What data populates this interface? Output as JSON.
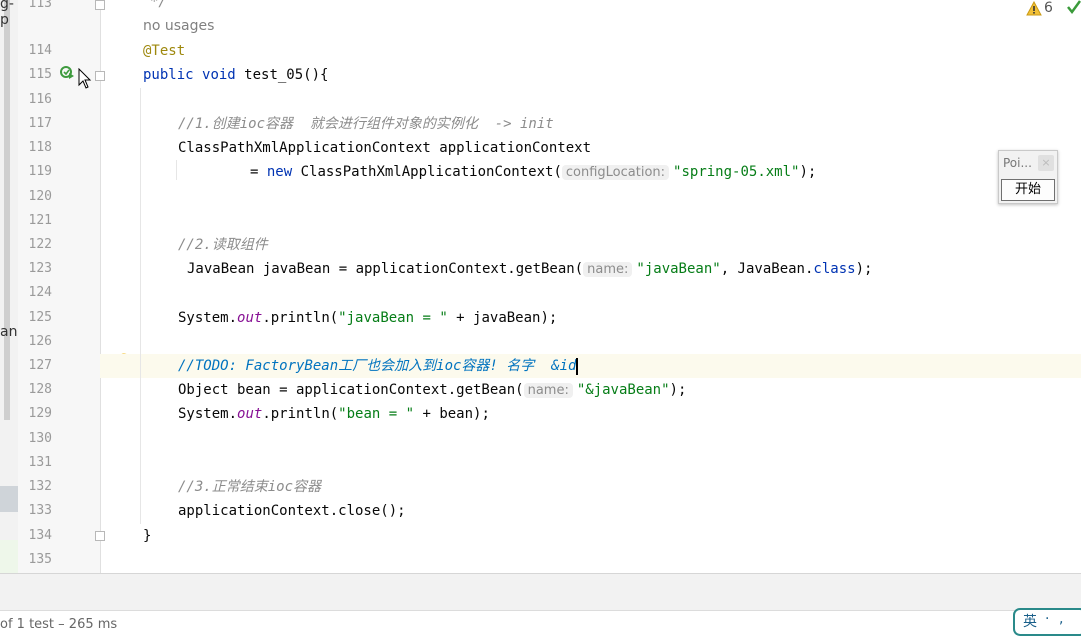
{
  "left_fragments": [
    "g-p",
    "an"
  ],
  "line_numbers": [
    "113",
    "114",
    "115",
    "116",
    "117",
    "118",
    "119",
    "120",
    "121",
    "122",
    "123",
    "124",
    "125",
    "126",
    "127",
    "128",
    "129",
    "130",
    "131",
    "132",
    "133",
    "134",
    "135"
  ],
  "code": {
    "line113": "*/",
    "usages": "no usages",
    "annotation": "@Test",
    "kw_public": "public",
    "kw_void": "void",
    "method_sig": " test_05(){",
    "comment1": "//1.创建ioc容器  就会进行组件对象的实例化  -> init",
    "line118": "ClassPathXmlApplicationContext applicationContext",
    "line119_prefix": "= ",
    "kw_new": "new",
    "line119_class": " ClassPathXmlApplicationContext(",
    "hint_config": "configLocation:",
    "str_spring": "\"spring-05.xml\"",
    "line119_end": ");",
    "comment2": "//2.读取组件",
    "line123_prefix": "JavaBean javaBean = applicationContext.getBean(",
    "hint_name": "name:",
    "str_javabean": "\"javaBean\"",
    "line123_mid": ", JavaBean.",
    "kw_class": "class",
    "line123_end": ");",
    "sys": "System.",
    "out": "out",
    "println": ".println(",
    "str_javabean_eq": "\"javaBean = \"",
    "line125_end": " + javaBean);",
    "todo_comment": "//TODO: FactoryBean工厂也会加入到ioc容器! 名字  &id",
    "line128_prefix": "Object bean = applicationContext.getBean(",
    "str_amp_javabean": "\"&javaBean\"",
    "line128_end": ");",
    "str_bean_eq": "\"bean = \"",
    "line129_end": " + bean);",
    "comment3": "//3.正常结束ioc容器",
    "line133": "applicationContext.close();",
    "closing_brace": "}"
  },
  "inspections": {
    "warning_count": "6"
  },
  "popup": {
    "title": "Poi...",
    "close": "×",
    "start_button": "开始"
  },
  "status": {
    "test_summary": "of 1 test – 265 ms"
  },
  "ime": {
    "lang": "英",
    "dots": "·",
    "mode": ","
  },
  "colors": {
    "keyword": "#0033b3",
    "string": "#067d17",
    "comment": "#8c8c8c",
    "todo": "#0073bf",
    "annotation": "#9e880d",
    "field": "#871094"
  }
}
